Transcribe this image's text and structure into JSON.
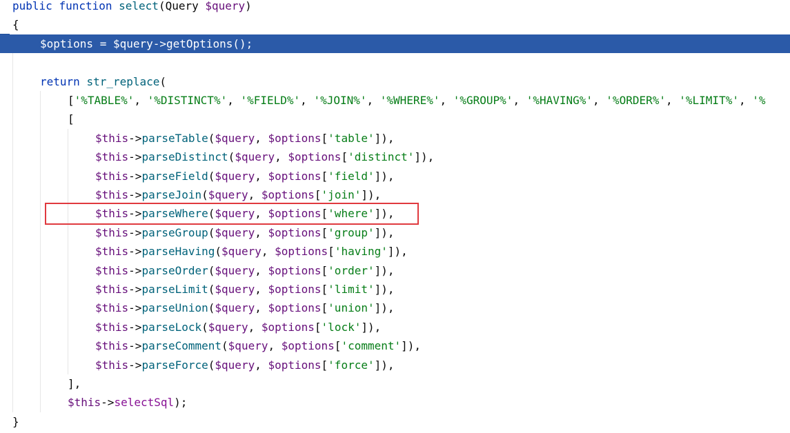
{
  "colors": {
    "keyword": "#0033b3",
    "variable": "#660e7a",
    "method": "#00627a",
    "string": "#067d17",
    "plain": "#080808",
    "highlight": "#2b5aa8",
    "annotation_box": "#e0393e"
  },
  "lines": [
    {
      "indent": 0,
      "highlighted": false,
      "tokens": [
        {
          "c": "k",
          "t": "public"
        },
        {
          "c": "p",
          "t": " "
        },
        {
          "c": "k",
          "t": "function"
        },
        {
          "c": "p",
          "t": " "
        },
        {
          "c": "m",
          "t": "select"
        },
        {
          "c": "p",
          "t": "(Query "
        },
        {
          "c": "v",
          "t": "$query"
        },
        {
          "c": "p",
          "t": ")"
        }
      ]
    },
    {
      "indent": 0,
      "highlighted": false,
      "tokens": [
        {
          "c": "p",
          "t": "{"
        }
      ]
    },
    {
      "indent": 1,
      "highlighted": true,
      "tokens": [
        {
          "c": "v",
          "t": "$options"
        },
        {
          "c": "p",
          "t": " = "
        },
        {
          "c": "v",
          "t": "$query"
        },
        {
          "c": "p",
          "t": "->"
        },
        {
          "c": "m",
          "t": "getOptions"
        },
        {
          "c": "p",
          "t": "();"
        }
      ]
    },
    {
      "indent": 0,
      "highlighted": false,
      "tokens": []
    },
    {
      "indent": 1,
      "highlighted": false,
      "tokens": [
        {
          "c": "k",
          "t": "return"
        },
        {
          "c": "p",
          "t": " "
        },
        {
          "c": "m",
          "t": "str_replace"
        },
        {
          "c": "p",
          "t": "("
        }
      ]
    },
    {
      "indent": 2,
      "highlighted": false,
      "tokens": [
        {
          "c": "p",
          "t": "["
        },
        {
          "c": "s",
          "t": "'%TABLE%'"
        },
        {
          "c": "p",
          "t": ", "
        },
        {
          "c": "s",
          "t": "'%DISTINCT%'"
        },
        {
          "c": "p",
          "t": ", "
        },
        {
          "c": "s",
          "t": "'%FIELD%'"
        },
        {
          "c": "p",
          "t": ", "
        },
        {
          "c": "s",
          "t": "'%JOIN%'"
        },
        {
          "c": "p",
          "t": ", "
        },
        {
          "c": "s",
          "t": "'%WHERE%'"
        },
        {
          "c": "p",
          "t": ", "
        },
        {
          "c": "s",
          "t": "'%GROUP%'"
        },
        {
          "c": "p",
          "t": ", "
        },
        {
          "c": "s",
          "t": "'%HAVING%'"
        },
        {
          "c": "p",
          "t": ", "
        },
        {
          "c": "s",
          "t": "'%ORDER%'"
        },
        {
          "c": "p",
          "t": ", "
        },
        {
          "c": "s",
          "t": "'%LIMIT%'"
        },
        {
          "c": "p",
          "t": ", "
        },
        {
          "c": "s",
          "t": "'%"
        }
      ]
    },
    {
      "indent": 2,
      "highlighted": false,
      "tokens": [
        {
          "c": "p",
          "t": "["
        }
      ]
    },
    {
      "indent": 3,
      "highlighted": false,
      "tokens": [
        {
          "c": "v",
          "t": "$this"
        },
        {
          "c": "p",
          "t": "->"
        },
        {
          "c": "m",
          "t": "parseTable"
        },
        {
          "c": "p",
          "t": "("
        },
        {
          "c": "v",
          "t": "$query"
        },
        {
          "c": "p",
          "t": ", "
        },
        {
          "c": "v",
          "t": "$options"
        },
        {
          "c": "p",
          "t": "["
        },
        {
          "c": "s",
          "t": "'table'"
        },
        {
          "c": "p",
          "t": "]),"
        }
      ]
    },
    {
      "indent": 3,
      "highlighted": false,
      "tokens": [
        {
          "c": "v",
          "t": "$this"
        },
        {
          "c": "p",
          "t": "->"
        },
        {
          "c": "m",
          "t": "parseDistinct"
        },
        {
          "c": "p",
          "t": "("
        },
        {
          "c": "v",
          "t": "$query"
        },
        {
          "c": "p",
          "t": ", "
        },
        {
          "c": "v",
          "t": "$options"
        },
        {
          "c": "p",
          "t": "["
        },
        {
          "c": "s",
          "t": "'distinct'"
        },
        {
          "c": "p",
          "t": "]),"
        }
      ]
    },
    {
      "indent": 3,
      "highlighted": false,
      "tokens": [
        {
          "c": "v",
          "t": "$this"
        },
        {
          "c": "p",
          "t": "->"
        },
        {
          "c": "m",
          "t": "parseField"
        },
        {
          "c": "p",
          "t": "("
        },
        {
          "c": "v",
          "t": "$query"
        },
        {
          "c": "p",
          "t": ", "
        },
        {
          "c": "v",
          "t": "$options"
        },
        {
          "c": "p",
          "t": "["
        },
        {
          "c": "s",
          "t": "'field'"
        },
        {
          "c": "p",
          "t": "]),"
        }
      ]
    },
    {
      "indent": 3,
      "highlighted": false,
      "tokens": [
        {
          "c": "v",
          "t": "$this"
        },
        {
          "c": "p",
          "t": "->"
        },
        {
          "c": "m",
          "t": "parseJoin"
        },
        {
          "c": "p",
          "t": "("
        },
        {
          "c": "v",
          "t": "$query"
        },
        {
          "c": "p",
          "t": ", "
        },
        {
          "c": "v",
          "t": "$options"
        },
        {
          "c": "p",
          "t": "["
        },
        {
          "c": "s",
          "t": "'join'"
        },
        {
          "c": "p",
          "t": "]),"
        }
      ]
    },
    {
      "indent": 3,
      "highlighted": false,
      "tokens": [
        {
          "c": "v",
          "t": "$this"
        },
        {
          "c": "p",
          "t": "->"
        },
        {
          "c": "m",
          "t": "parseWhere"
        },
        {
          "c": "p",
          "t": "("
        },
        {
          "c": "v",
          "t": "$query"
        },
        {
          "c": "p",
          "t": ", "
        },
        {
          "c": "v",
          "t": "$options"
        },
        {
          "c": "p",
          "t": "["
        },
        {
          "c": "s",
          "t": "'where'"
        },
        {
          "c": "p",
          "t": "]),"
        }
      ]
    },
    {
      "indent": 3,
      "highlighted": false,
      "tokens": [
        {
          "c": "v",
          "t": "$this"
        },
        {
          "c": "p",
          "t": "->"
        },
        {
          "c": "m",
          "t": "parseGroup"
        },
        {
          "c": "p",
          "t": "("
        },
        {
          "c": "v",
          "t": "$query"
        },
        {
          "c": "p",
          "t": ", "
        },
        {
          "c": "v",
          "t": "$options"
        },
        {
          "c": "p",
          "t": "["
        },
        {
          "c": "s",
          "t": "'group'"
        },
        {
          "c": "p",
          "t": "]),"
        }
      ]
    },
    {
      "indent": 3,
      "highlighted": false,
      "tokens": [
        {
          "c": "v",
          "t": "$this"
        },
        {
          "c": "p",
          "t": "->"
        },
        {
          "c": "m",
          "t": "parseHaving"
        },
        {
          "c": "p",
          "t": "("
        },
        {
          "c": "v",
          "t": "$query"
        },
        {
          "c": "p",
          "t": ", "
        },
        {
          "c": "v",
          "t": "$options"
        },
        {
          "c": "p",
          "t": "["
        },
        {
          "c": "s",
          "t": "'having'"
        },
        {
          "c": "p",
          "t": "]),"
        }
      ]
    },
    {
      "indent": 3,
      "highlighted": false,
      "tokens": [
        {
          "c": "v",
          "t": "$this"
        },
        {
          "c": "p",
          "t": "->"
        },
        {
          "c": "m",
          "t": "parseOrder"
        },
        {
          "c": "p",
          "t": "("
        },
        {
          "c": "v",
          "t": "$query"
        },
        {
          "c": "p",
          "t": ", "
        },
        {
          "c": "v",
          "t": "$options"
        },
        {
          "c": "p",
          "t": "["
        },
        {
          "c": "s",
          "t": "'order'"
        },
        {
          "c": "p",
          "t": "]),"
        }
      ]
    },
    {
      "indent": 3,
      "highlighted": false,
      "tokens": [
        {
          "c": "v",
          "t": "$this"
        },
        {
          "c": "p",
          "t": "->"
        },
        {
          "c": "m",
          "t": "parseLimit"
        },
        {
          "c": "p",
          "t": "("
        },
        {
          "c": "v",
          "t": "$query"
        },
        {
          "c": "p",
          "t": ", "
        },
        {
          "c": "v",
          "t": "$options"
        },
        {
          "c": "p",
          "t": "["
        },
        {
          "c": "s",
          "t": "'limit'"
        },
        {
          "c": "p",
          "t": "]),"
        }
      ]
    },
    {
      "indent": 3,
      "highlighted": false,
      "tokens": [
        {
          "c": "v",
          "t": "$this"
        },
        {
          "c": "p",
          "t": "->"
        },
        {
          "c": "m",
          "t": "parseUnion"
        },
        {
          "c": "p",
          "t": "("
        },
        {
          "c": "v",
          "t": "$query"
        },
        {
          "c": "p",
          "t": ", "
        },
        {
          "c": "v",
          "t": "$options"
        },
        {
          "c": "p",
          "t": "["
        },
        {
          "c": "s",
          "t": "'union'"
        },
        {
          "c": "p",
          "t": "]),"
        }
      ]
    },
    {
      "indent": 3,
      "highlighted": false,
      "tokens": [
        {
          "c": "v",
          "t": "$this"
        },
        {
          "c": "p",
          "t": "->"
        },
        {
          "c": "m",
          "t": "parseLock"
        },
        {
          "c": "p",
          "t": "("
        },
        {
          "c": "v",
          "t": "$query"
        },
        {
          "c": "p",
          "t": ", "
        },
        {
          "c": "v",
          "t": "$options"
        },
        {
          "c": "p",
          "t": "["
        },
        {
          "c": "s",
          "t": "'lock'"
        },
        {
          "c": "p",
          "t": "]),"
        }
      ]
    },
    {
      "indent": 3,
      "highlighted": false,
      "tokens": [
        {
          "c": "v",
          "t": "$this"
        },
        {
          "c": "p",
          "t": "->"
        },
        {
          "c": "m",
          "t": "parseComment"
        },
        {
          "c": "p",
          "t": "("
        },
        {
          "c": "v",
          "t": "$query"
        },
        {
          "c": "p",
          "t": ", "
        },
        {
          "c": "v",
          "t": "$options"
        },
        {
          "c": "p",
          "t": "["
        },
        {
          "c": "s",
          "t": "'comment'"
        },
        {
          "c": "p",
          "t": "]),"
        }
      ]
    },
    {
      "indent": 3,
      "highlighted": false,
      "tokens": [
        {
          "c": "v",
          "t": "$this"
        },
        {
          "c": "p",
          "t": "->"
        },
        {
          "c": "m",
          "t": "parseForce"
        },
        {
          "c": "p",
          "t": "("
        },
        {
          "c": "v",
          "t": "$query"
        },
        {
          "c": "p",
          "t": ", "
        },
        {
          "c": "v",
          "t": "$options"
        },
        {
          "c": "p",
          "t": "["
        },
        {
          "c": "s",
          "t": "'force'"
        },
        {
          "c": "p",
          "t": "]),"
        }
      ]
    },
    {
      "indent": 2,
      "highlighted": false,
      "tokens": [
        {
          "c": "p",
          "t": "],"
        }
      ]
    },
    {
      "indent": 2,
      "highlighted": false,
      "tokens": [
        {
          "c": "v",
          "t": "$this"
        },
        {
          "c": "p",
          "t": "->"
        },
        {
          "c": "vd",
          "t": "selectSql"
        },
        {
          "c": "p",
          "t": ");"
        }
      ]
    },
    {
      "indent": 0,
      "highlighted": false,
      "tokens": [
        {
          "c": "p",
          "t": "}"
        }
      ]
    }
  ]
}
